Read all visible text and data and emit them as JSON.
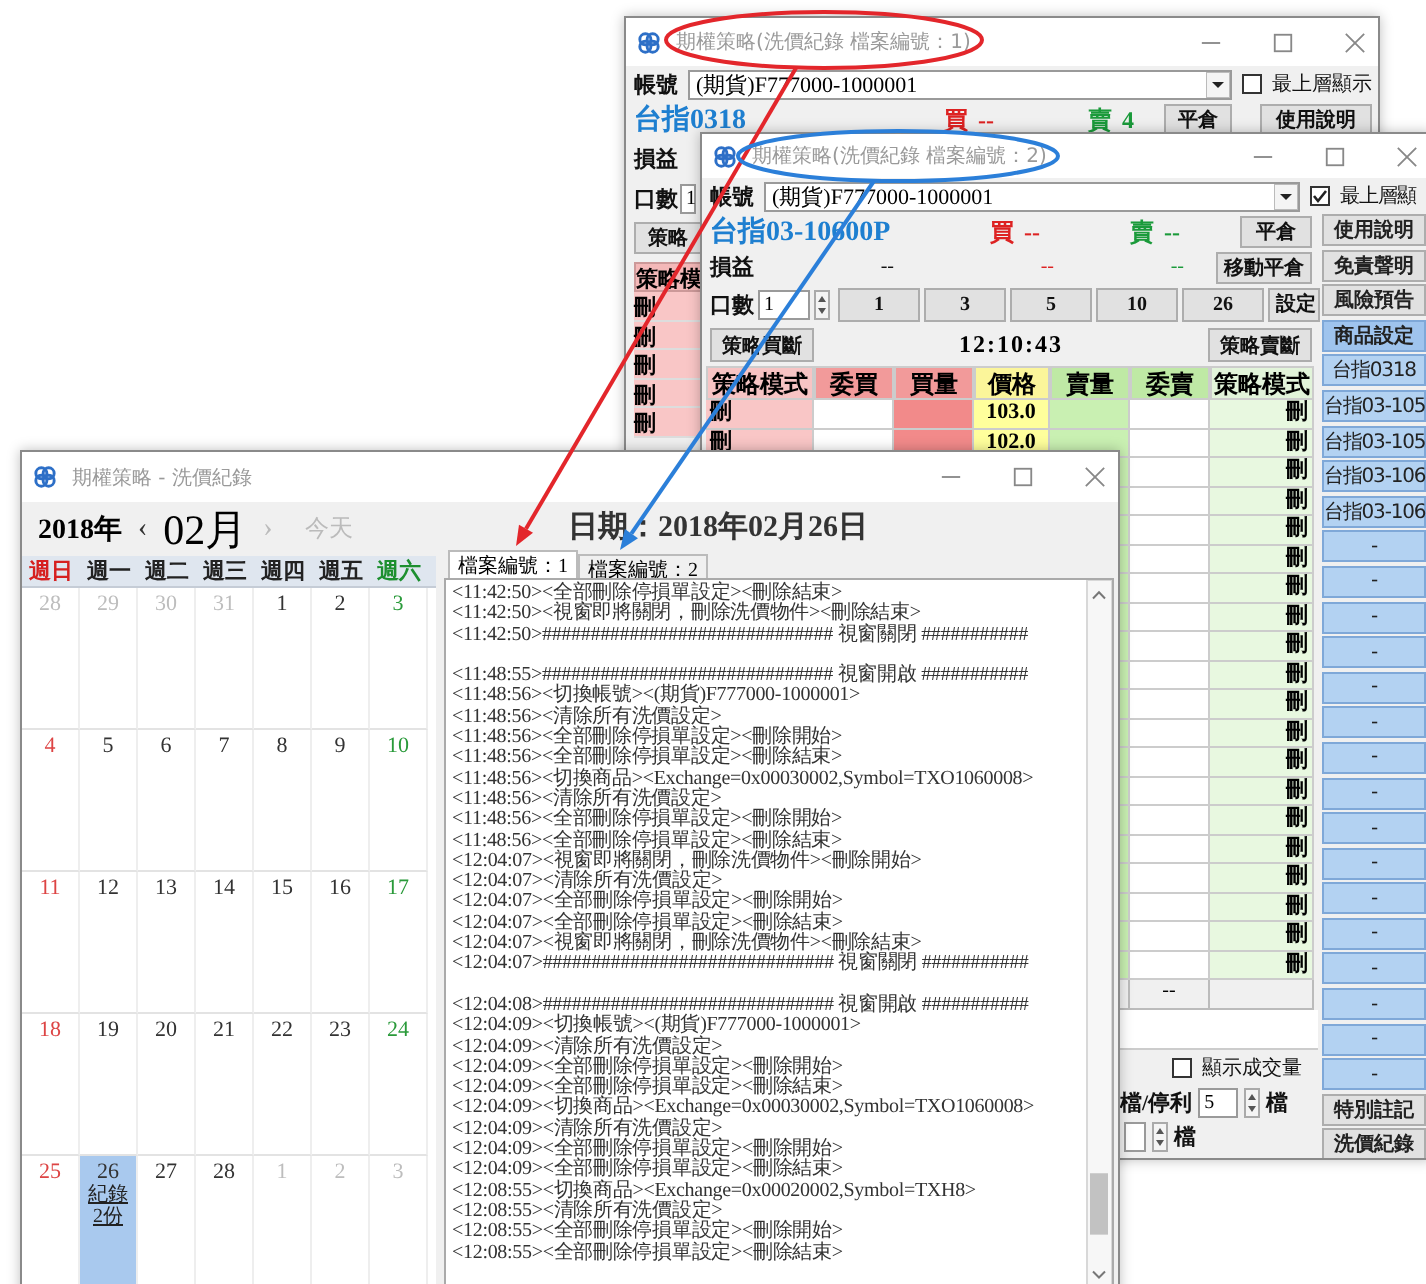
{
  "back_window": {
    "title": "期權策略(洗價紀錄 檔案編號：1)",
    "account_label": "帳號",
    "account": "(期貨)F777000-1000001",
    "topmost": {
      "label": "最上層顯示",
      "checked": false
    },
    "symbol": "台指0318",
    "buy_label": "買",
    "buy_value": "--",
    "sell_label": "賣",
    "sell_value": "4",
    "close_button": "平倉",
    "help_button": "使用說明",
    "pnl_label": "損益",
    "qty_label": "口數",
    "qty_value": "1",
    "strategy_button": "策略",
    "mode_header": "策略模",
    "mode_cells": [
      "刪",
      "刪",
      "刪",
      "刪",
      "刪"
    ]
  },
  "front_window": {
    "title": "期權策略(洗價紀錄 檔案編號：2)",
    "account_label": "帳號",
    "account": "(期貨)F777000-1000001",
    "topmost": {
      "label": "最上層顯",
      "checked": true
    },
    "symbol": "台指03-10600P",
    "buy_label": "買",
    "buy_value": "--",
    "sell_label": "賣",
    "sell_value": "--",
    "close_button": "平倉",
    "pnl_label": "損益",
    "pnl_values": [
      "--",
      "--",
      "--"
    ],
    "trailing_button": "移動平倉",
    "qty_label": "口數",
    "qty_value": "1",
    "qty_buttons": [
      "1",
      "3",
      "5",
      "10",
      "26"
    ],
    "set_button": "設定",
    "buy_strategy_button": "策略買斷",
    "time": "12:10:43",
    "sell_strategy_button": "策略賣斷",
    "table": {
      "columns": [
        "策略模式",
        "委買",
        "買量",
        "價格",
        "賣量",
        "委賣",
        "策略模式"
      ],
      "rows": [
        {
          "buy_mode": "刪",
          "price": "103.0",
          "sell_mode": "刪"
        },
        {
          "buy_mode": "刪",
          "price": "102.0",
          "sell_mode": "刪"
        },
        {
          "sell_mode": "刪"
        },
        {
          "sell_mode": "刪"
        },
        {
          "sell_mode": "刪"
        },
        {
          "sell_mode": "刪"
        },
        {
          "sell_mode": "刪"
        },
        {
          "sell_mode": "刪"
        },
        {
          "sell_mode": "刪"
        },
        {
          "sell_mode": "刪"
        },
        {
          "sell_mode": "刪"
        },
        {
          "sell_mode": "刪"
        },
        {
          "sell_mode": "刪"
        },
        {
          "sell_mode": "刪"
        },
        {
          "sell_mode": "刪"
        },
        {
          "sell_mode": "刪"
        },
        {
          "sell_mode": "刪"
        },
        {
          "sell_mode": "刪"
        },
        {
          "sell_mode": "刪"
        },
        {
          "sell_mode": "刪"
        }
      ],
      "footer_sell_order": "--"
    },
    "show_volume": {
      "label": "顯示成交量",
      "checked": false
    },
    "take_profit": {
      "label": "檔/停利",
      "value": "5",
      "unit": "檔"
    },
    "stop_unit": "檔",
    "sidebar": [
      {
        "label": "使用說明",
        "kind": "action"
      },
      {
        "label": "免責聲明",
        "kind": "action"
      },
      {
        "label": "風險預告",
        "kind": "action"
      },
      {
        "label": "商品設定",
        "kind": "header"
      },
      {
        "label": "台指0318",
        "kind": "product"
      },
      {
        "label": "台指03-105",
        "kind": "product"
      },
      {
        "label": "台指03-105",
        "kind": "product"
      },
      {
        "label": "台指03-106",
        "kind": "product"
      },
      {
        "label": "台指03-106",
        "kind": "product"
      },
      {
        "label": "-",
        "kind": "product"
      },
      {
        "label": "-",
        "kind": "product"
      },
      {
        "label": "-",
        "kind": "product"
      },
      {
        "label": "-",
        "kind": "product"
      },
      {
        "label": "-",
        "kind": "product"
      },
      {
        "label": "-",
        "kind": "product"
      },
      {
        "label": "-",
        "kind": "product"
      },
      {
        "label": "-",
        "kind": "product"
      },
      {
        "label": "-",
        "kind": "product"
      },
      {
        "label": "-",
        "kind": "product"
      },
      {
        "label": "-",
        "kind": "product"
      },
      {
        "label": "-",
        "kind": "product"
      },
      {
        "label": "-",
        "kind": "product"
      },
      {
        "label": "-",
        "kind": "product"
      },
      {
        "label": "-",
        "kind": "product"
      },
      {
        "label": "-",
        "kind": "product"
      },
      {
        "label": "特別註記",
        "kind": "action"
      },
      {
        "label": "洗價紀錄",
        "kind": "action"
      }
    ]
  },
  "log_window": {
    "title": "期權策略 - 洗價紀錄",
    "calendar": {
      "year": "2018年",
      "prev": "‹",
      "month": "02月",
      "next": "›",
      "today": "今天",
      "weekdays": [
        "週日",
        "週一",
        "週二",
        "週三",
        "週四",
        "週五",
        "週六"
      ],
      "weeks": [
        [
          {
            "day": "28",
            "other_month": true,
            "selected": false
          },
          {
            "day": "29",
            "other_month": true,
            "selected": false
          },
          {
            "day": "30",
            "other_month": true,
            "selected": false
          },
          {
            "day": "31",
            "other_month": true,
            "selected": false
          },
          {
            "day": "1",
            "other_month": false,
            "selected": false
          },
          {
            "day": "2",
            "other_month": false,
            "selected": false
          },
          {
            "day": "3",
            "other_month": false,
            "selected": false
          }
        ],
        [
          {
            "day": "4",
            "other_month": false,
            "selected": false
          },
          {
            "day": "5",
            "other_month": false,
            "selected": false
          },
          {
            "day": "6",
            "other_month": false,
            "selected": false
          },
          {
            "day": "7",
            "other_month": false,
            "selected": false
          },
          {
            "day": "8",
            "other_month": false,
            "selected": false
          },
          {
            "day": "9",
            "other_month": false,
            "selected": false
          },
          {
            "day": "10",
            "other_month": false,
            "selected": false
          }
        ],
        [
          {
            "day": "11",
            "other_month": false,
            "selected": false
          },
          {
            "day": "12",
            "other_month": false,
            "selected": false
          },
          {
            "day": "13",
            "other_month": false,
            "selected": false
          },
          {
            "day": "14",
            "other_month": false,
            "selected": false
          },
          {
            "day": "15",
            "other_month": false,
            "selected": false
          },
          {
            "day": "16",
            "other_month": false,
            "selected": false
          },
          {
            "day": "17",
            "other_month": false,
            "selected": false
          }
        ],
        [
          {
            "day": "18",
            "other_month": false,
            "selected": false
          },
          {
            "day": "19",
            "other_month": false,
            "selected": false
          },
          {
            "day": "20",
            "other_month": false,
            "selected": false
          },
          {
            "day": "21",
            "other_month": false,
            "selected": false
          },
          {
            "day": "22",
            "other_month": false,
            "selected": false
          },
          {
            "day": "23",
            "other_month": false,
            "selected": false
          },
          {
            "day": "24",
            "other_month": false,
            "selected": false
          }
        ],
        [
          {
            "day": "25",
            "other_month": false,
            "selected": false
          },
          {
            "day": "26",
            "other_month": false,
            "selected": true,
            "links": [
              "紀錄",
              "2份"
            ]
          },
          {
            "day": "27",
            "other_month": false,
            "selected": false
          },
          {
            "day": "28",
            "other_month": false,
            "selected": false
          },
          {
            "day": "1",
            "other_month": true,
            "selected": false
          },
          {
            "day": "2",
            "other_month": true,
            "selected": false
          },
          {
            "day": "3",
            "other_month": true,
            "selected": false
          }
        ]
      ]
    },
    "date_title": "日期：2018年02月26日",
    "tabs": [
      {
        "label": "檔案編號：1",
        "selected": true
      },
      {
        "label": "檔案編號：2",
        "selected": false
      }
    ],
    "log_blocks": [
      [
        "<11:42:50><全部刪除停損單設定><刪除結束>",
        "<11:42:50><視窗即將關閉，刪除洗價物件><刪除結束>",
        "<11:42:50>############################## 視窗關閉 ###########"
      ],
      [
        "<11:48:55>############################## 視窗開啟 ###########",
        "<11:48:56><切換帳號><(期貨)F777000-1000001>",
        "<11:48:56><清除所有洗價設定>",
        "<11:48:56><全部刪除停損單設定><刪除開始>",
        "<11:48:56><全部刪除停損單設定><刪除結束>",
        "<11:48:56><切換商品><Exchange=0x00030002,Symbol=TXO1060008>",
        "<11:48:56><清除所有洗價設定>",
        "<11:48:56><全部刪除停損單設定><刪除開始>",
        "<11:48:56><全部刪除停損單設定><刪除結束>",
        "<12:04:07><視窗即將關閉，刪除洗價物件><刪除開始>",
        "<12:04:07><清除所有洗價設定>",
        "<12:04:07><全部刪除停損單設定><刪除開始>",
        "<12:04:07><全部刪除停損單設定><刪除結束>",
        "<12:04:07><視窗即將關閉，刪除洗價物件><刪除結束>",
        "<12:04:07>############################## 視窗關閉 ###########"
      ],
      [
        "<12:04:08>############################## 視窗開啟 ###########",
        "<12:04:09><切換帳號><(期貨)F777000-1000001>",
        "<12:04:09><清除所有洗價設定>",
        "<12:04:09><全部刪除停損單設定><刪除開始>",
        "<12:04:09><全部刪除停損單設定><刪除結束>",
        "<12:04:09><切換商品><Exchange=0x00030002,Symbol=TXO1060008>",
        "<12:04:09><清除所有洗價設定>",
        "<12:04:09><全部刪除停損單設定><刪除開始>",
        "<12:04:09><全部刪除停損單設定><刪除結束>",
        "<12:08:55><切換商品><Exchange=0x00020002,Symbol=TXH8>",
        "<12:08:55><清除所有洗價設定>",
        "<12:08:55><全部刪除停損單設定><刪除開始>",
        "<12:08:55><全部刪除停損單設定><刪除結束>"
      ]
    ]
  },
  "annotations": [
    {
      "color": "#e3262b"
    },
    {
      "color": "#2b7fd9"
    }
  ]
}
